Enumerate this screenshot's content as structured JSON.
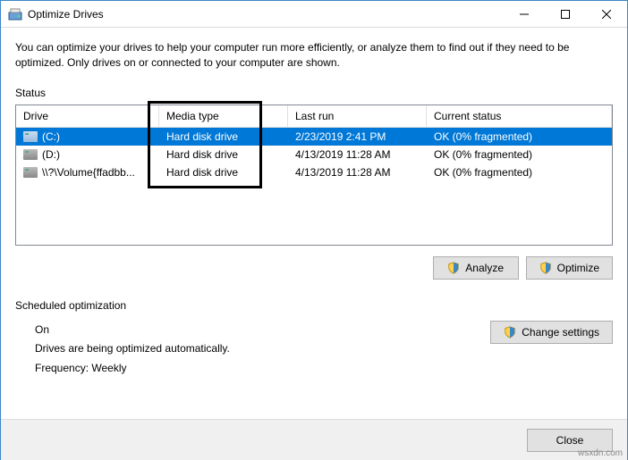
{
  "window": {
    "title": "Optimize Drives"
  },
  "description": "You can optimize your drives to help your computer run more efficiently, or analyze them to find out if they need to be optimized. Only drives on or connected to your computer are shown.",
  "status_label": "Status",
  "columns": {
    "drive": "Drive",
    "media": "Media type",
    "lastrun": "Last run",
    "status": "Current status"
  },
  "rows": [
    {
      "drive": "(C:)",
      "media": "Hard disk drive",
      "lastrun": "2/23/2019 2:41 PM",
      "status": "OK (0% fragmented)"
    },
    {
      "drive": "(D:)",
      "media": "Hard disk drive",
      "lastrun": "4/13/2019 11:28 AM",
      "status": "OK (0% fragmented)"
    },
    {
      "drive": "\\\\?\\Volume{ffadbb...",
      "media": "Hard disk drive",
      "lastrun": "4/13/2019 11:28 AM",
      "status": "OK (0% fragmented)"
    }
  ],
  "buttons": {
    "analyze": "Analyze",
    "optimize": "Optimize",
    "change_settings": "Change settings",
    "close": "Close"
  },
  "scheduled": {
    "label": "Scheduled optimization",
    "state": "On",
    "desc": "Drives are being optimized automatically.",
    "freq": "Frequency: Weekly"
  },
  "watermark": "wsxdn.com"
}
